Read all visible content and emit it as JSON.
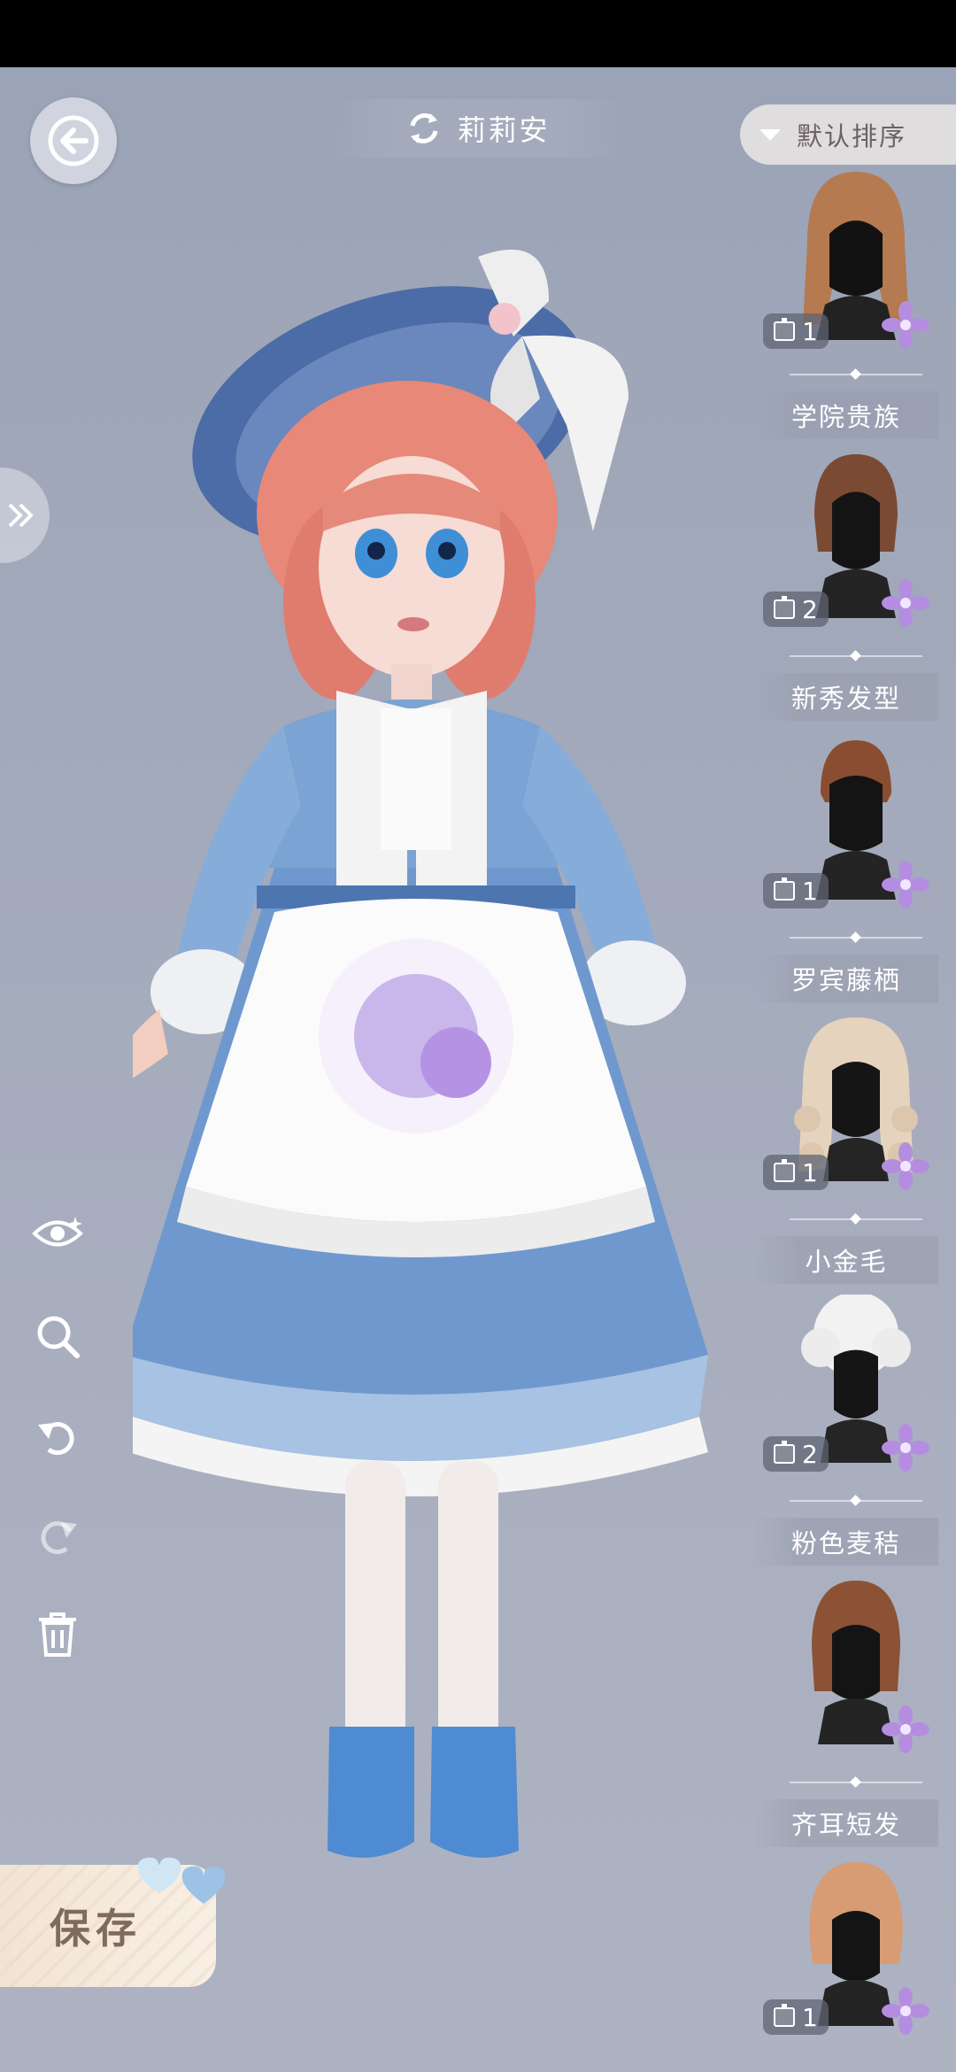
{
  "header": {
    "character_name": "莉莉安",
    "sort_label": "默认排序"
  },
  "hair_items": [
    {
      "name": "",
      "count": "1",
      "color": "#b57a4f"
    },
    {
      "name": "学院贵族",
      "count": "2",
      "color": "#7b4a33"
    },
    {
      "name": "新秀发型",
      "count": "1",
      "color": "#8a4d31"
    },
    {
      "name": "罗宾藤栖",
      "count": "1",
      "color": "#e6d3bd"
    },
    {
      "name": "小金毛",
      "count": "2",
      "color": "#f2f2f2"
    },
    {
      "name": "粉色麦秸",
      "count": "",
      "color": "#8b5236"
    },
    {
      "name": "齐耳短发",
      "count": "1",
      "color": "#d79c74"
    }
  ],
  "tools": [
    "eye-icon",
    "zoom-icon",
    "undo-icon",
    "redo-icon",
    "trash-icon"
  ],
  "save_label": "保存",
  "colors": {
    "accent_purple": "#b58de0",
    "dress_blue": "#6e97c9",
    "sort_bg": "#e8e5e2"
  }
}
